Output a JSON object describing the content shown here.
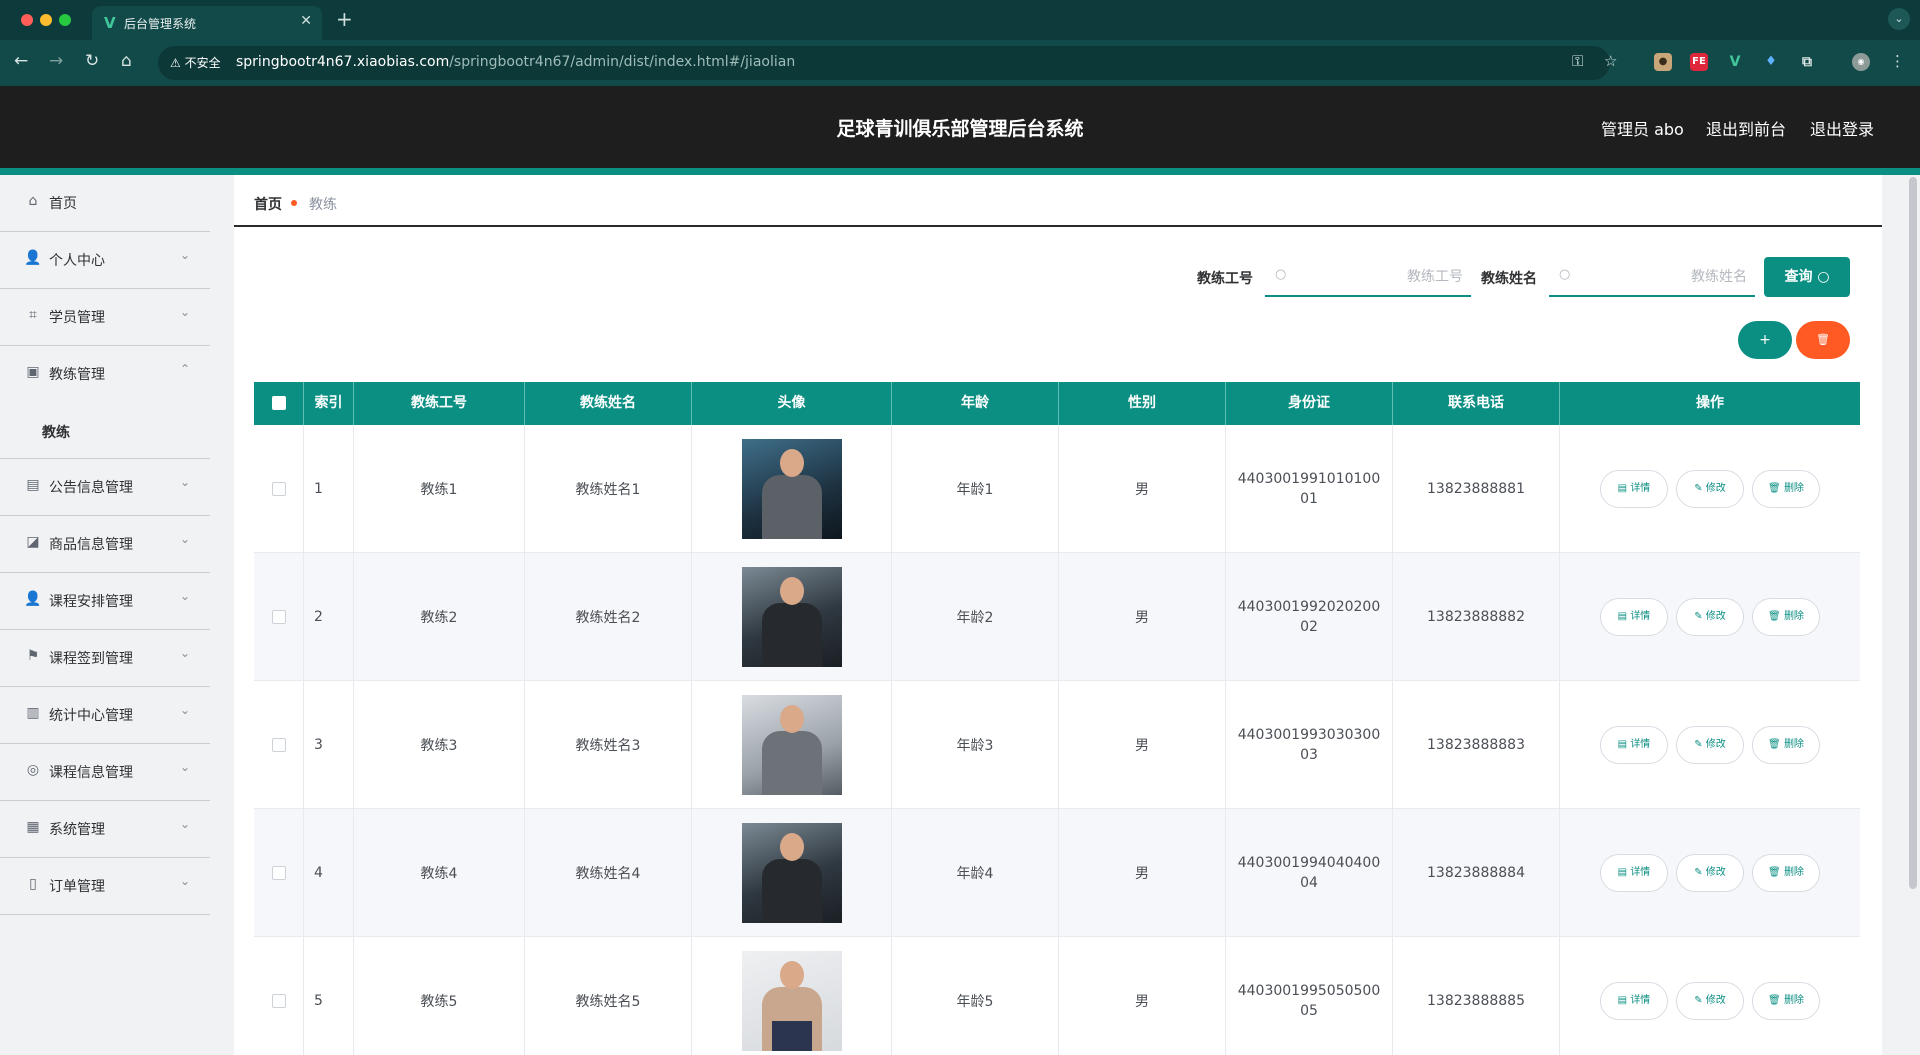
{
  "browser": {
    "tab_title": "后台管理系统",
    "tab_favicon": "V",
    "insecure_label": "不安全",
    "url_host": "springbootr4n67.xiaobias.com",
    "url_path": "/springbootr4n67/admin/dist/index.html#/jiaolian"
  },
  "header": {
    "title": "足球青训俱乐部管理后台系统",
    "admin_label": "管理员 abo",
    "exit_front": "退出到前台",
    "logout": "退出登录"
  },
  "sidebar": {
    "items": [
      {
        "label": "首页",
        "icon": "home-icon"
      },
      {
        "label": "个人中心",
        "icon": "user-icon"
      },
      {
        "label": "学员管理",
        "icon": "crop-icon"
      },
      {
        "label": "教练管理",
        "icon": "briefcase-icon"
      },
      {
        "label": "公告信息管理",
        "icon": "notice-icon"
      },
      {
        "label": "商品信息管理",
        "icon": "chart-icon"
      },
      {
        "label": "课程安排管理",
        "icon": "user-icon"
      },
      {
        "label": "课程签到管理",
        "icon": "flag-icon"
      },
      {
        "label": "统计中心管理",
        "icon": "stats-icon"
      },
      {
        "label": "课程信息管理",
        "icon": "compass-icon"
      },
      {
        "label": "系统管理",
        "icon": "clipboard-icon"
      },
      {
        "label": "订单管理",
        "icon": "mic-icon"
      }
    ],
    "sub_item": "教练"
  },
  "breadcrumb": {
    "home": "首页",
    "current": "教练"
  },
  "search": {
    "field1_label": "教练工号",
    "field1_placeholder": "教练工号",
    "field2_label": "教练姓名",
    "field2_placeholder": "教练姓名",
    "query_label": "查询"
  },
  "toolbar": {
    "add": "+",
    "delete": "🗑"
  },
  "table": {
    "headers": [
      "索引",
      "教练工号",
      "教练姓名",
      "头像",
      "年龄",
      "性别",
      "身份证",
      "联系电话",
      "操作"
    ],
    "rows": [
      {
        "index": "1",
        "code": "教练1",
        "name": "教练姓名1",
        "age": "年龄1",
        "gender": "男",
        "id_card": "440300199101010001",
        "phone": "13823888881"
      },
      {
        "index": "2",
        "code": "教练2",
        "name": "教练姓名2",
        "age": "年龄2",
        "gender": "男",
        "id_card": "440300199202020002",
        "phone": "13823888882"
      },
      {
        "index": "3",
        "code": "教练3",
        "name": "教练姓名3",
        "age": "年龄3",
        "gender": "男",
        "id_card": "440300199303030003",
        "phone": "13823888883"
      },
      {
        "index": "4",
        "code": "教练4",
        "name": "教练姓名4",
        "age": "年龄4",
        "gender": "男",
        "id_card": "440300199404040004",
        "phone": "13823888884"
      },
      {
        "index": "5",
        "code": "教练5",
        "name": "教练姓名5",
        "age": "年龄5",
        "gender": "男",
        "id_card": "440300199505050005",
        "phone": "13823888885"
      }
    ],
    "actions": {
      "detail": "详情",
      "edit": "修改",
      "delete": "删除"
    }
  },
  "colors": {
    "primary": "#0b8f83",
    "danger": "#ff5a24",
    "header_bg": "#1e1e1e"
  }
}
